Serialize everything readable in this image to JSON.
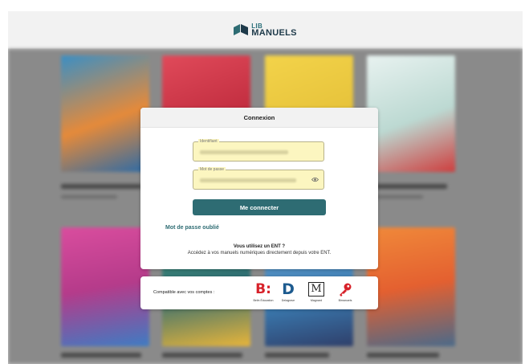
{
  "header": {
    "logo_small": "LIB",
    "logo_big": "MANUELS"
  },
  "login": {
    "title": "Connexion",
    "identifiant_label": "Identifiant",
    "password_label": "Mot de passe",
    "submit_label": "Me connecter",
    "forgot_label": "Mot de passe oublié",
    "ent_question": "Vous utilisez un ENT ?",
    "ent_description": "Accédez à vos manuels numériques directement depuis votre ENT."
  },
  "compat": {
    "label": "Compatible avec vos comptes :",
    "brands": [
      {
        "mark": "B:",
        "name": "Belin Éducation",
        "color": "#d7222a"
      },
      {
        "mark": "D",
        "name": "Delagrave",
        "color": "#1d5b8f"
      },
      {
        "mark": "M",
        "name": "Magnard",
        "color": "#222222"
      },
      {
        "mark": "key-icon",
        "name": "Bimanuels",
        "color": "#d7222a"
      }
    ]
  },
  "colors": {
    "accent": "#2e6c73",
    "field_bg": "#fcf6c0",
    "overlay": "#8a8a8a"
  }
}
